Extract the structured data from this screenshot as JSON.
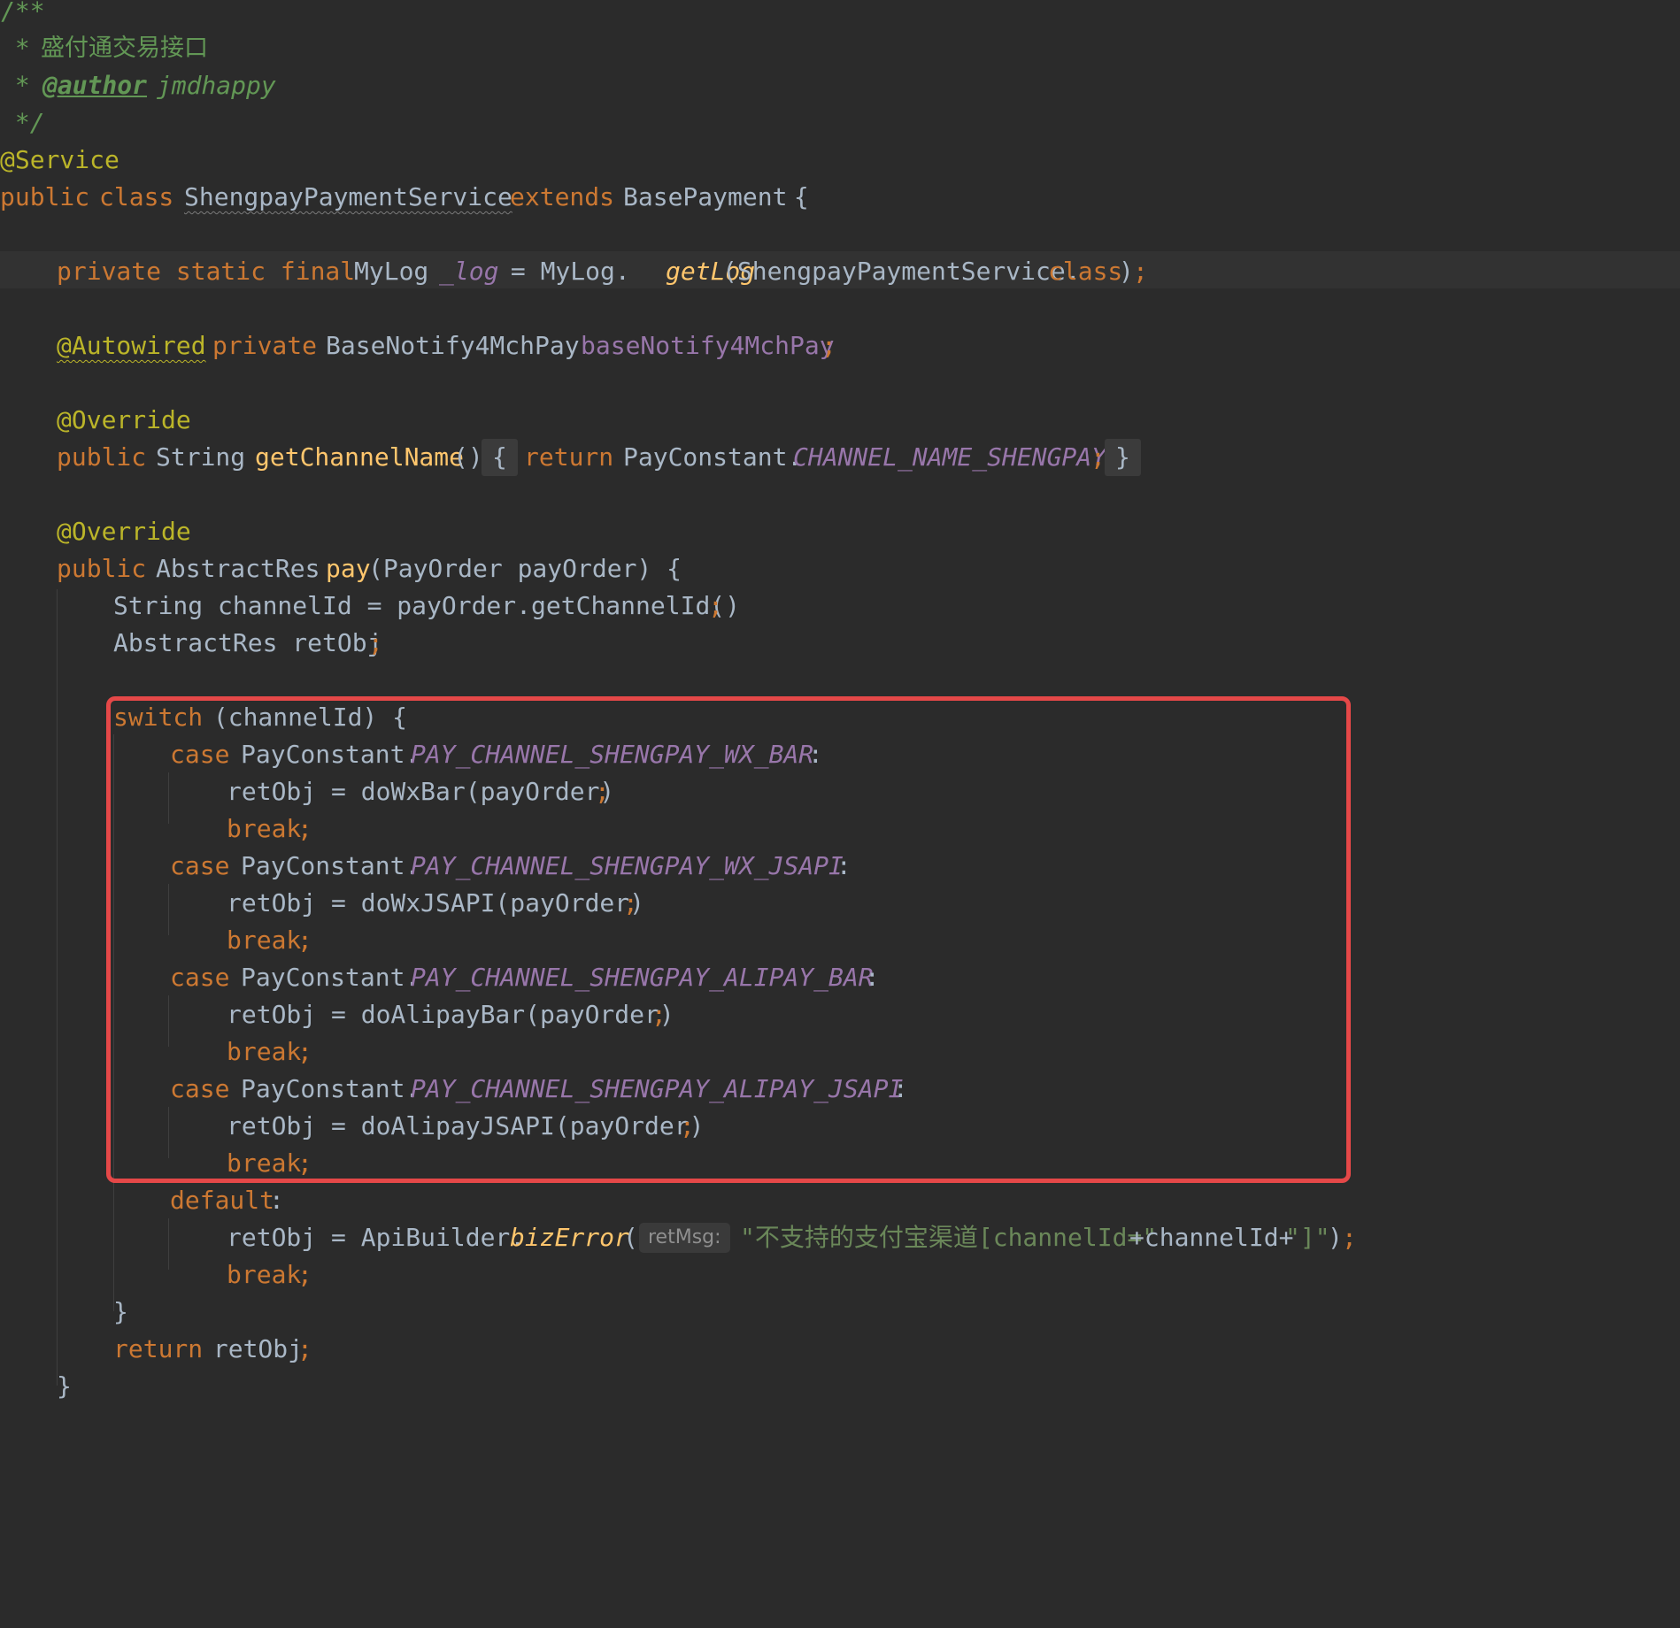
{
  "doc": {
    "comment_open": "/**",
    "comment_line1_prefix": " * ",
    "comment_line1_text": "盛付通交易接口",
    "comment_line2_prefix": " * ",
    "comment_author_tag": "@author",
    "comment_author_value": " jmdhappy",
    "comment_close": " */"
  },
  "class_decl": {
    "annotation": "@Service",
    "kw_public": "public",
    "kw_class": "class",
    "name": "ShengpayPaymentService",
    "kw_extends": "extends",
    "parent": "BasePayment",
    "brace": " {"
  },
  "field_log": {
    "modifiers": "private static final",
    "type": "MyLog",
    "name": "_log",
    "assign": " = MyLog.",
    "method": "getLog",
    "arg": "(ShengpayPaymentService.",
    "kw_class": "class",
    "close": ")",
    "semi": ";"
  },
  "field_notify": {
    "annotation": "@Autowired",
    "modifier": "private",
    "type": "BaseNotify4MchPay",
    "name": "baseNotify4MchPay",
    "semi": ";"
  },
  "method_channel": {
    "annotation": "@Override",
    "kw_public": "public",
    "ret_type": "String",
    "name": "getChannelName",
    "params": "()",
    "open": "{",
    "kw_return": "return",
    "owner": "PayConstant.",
    "constant": "CHANNEL_NAME_SHENGPAY",
    "semi": ";",
    "close": "}"
  },
  "method_pay": {
    "annotation": "@Override",
    "kw_public": "public",
    "ret_type": "AbstractRes",
    "name": "pay",
    "params": "(PayOrder payOrder) {",
    "stmt1": "String channelId = payOrder.getChannelId()",
    "stmt2": "AbstractRes retObj",
    "semi": ";"
  },
  "switch_block": {
    "kw_switch": "switch",
    "expr": " (channelId) {",
    "kw_case": "case",
    "kw_break": "break",
    "kw_default": "default",
    "owner": "PayConstant.",
    "colon": " :",
    "semi": ";",
    "cases": [
      {
        "constant": "PAY_CHANNEL_SHENGPAY_WX_BAR",
        "call": "retObj = doWxBar(payOrder)"
      },
      {
        "constant": "PAY_CHANNEL_SHENGPAY_WX_JSAPI",
        "call": "retObj = doWxJSAPI(payOrder)"
      },
      {
        "constant": "PAY_CHANNEL_SHENGPAY_ALIPAY_BAR",
        "call": "retObj = doAlipayBar(payOrder)"
      },
      {
        "constant": "PAY_CHANNEL_SHENGPAY_ALIPAY_JSAPI",
        "call": "retObj = doAlipayJSAPI(payOrder)"
      }
    ],
    "default_colon": ":",
    "default_prefix": "retObj = ApiBuilder.",
    "default_method": "bizError",
    "default_paren": "(",
    "param_hint": "retMsg:",
    "default_string1": "\"不支持的支付宝渠道[channelId=\"",
    "default_concat1": "+channelId+",
    "default_string2": "\"]\"",
    "default_close": ")",
    "close_brace": "}",
    "kw_return": "return",
    "return_value": " retObj",
    "method_close": "}"
  },
  "highlight_box_color": "#e54848"
}
